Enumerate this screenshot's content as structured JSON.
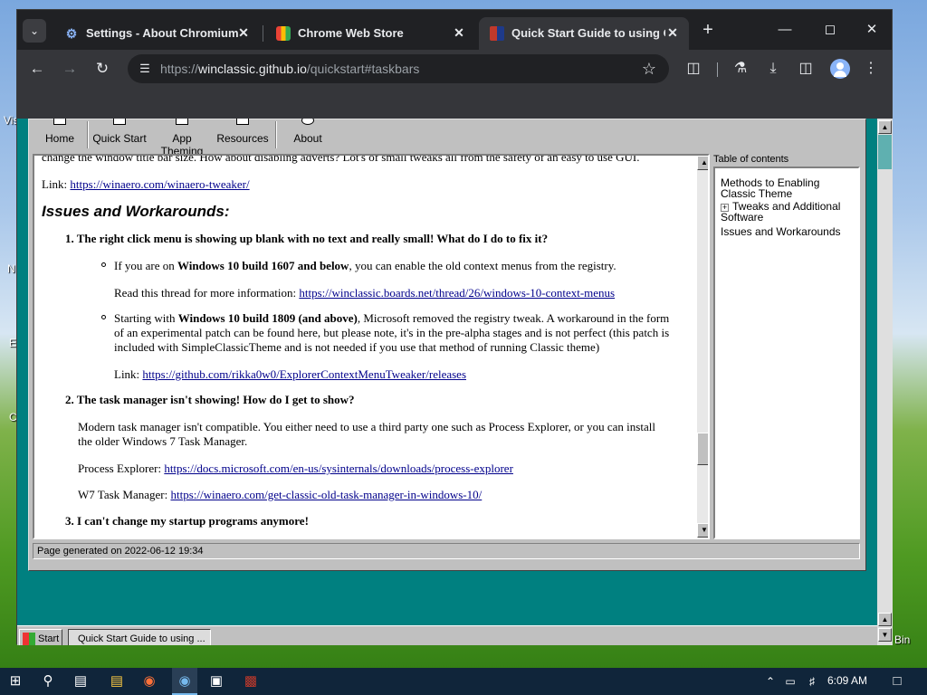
{
  "desktop": {
    "labels": [
      "Vis",
      "N",
      "E",
      "C",
      "Bin"
    ]
  },
  "browser": {
    "tabs": [
      {
        "title": "Settings - About Chromium",
        "icon": "gear-icon",
        "active": false
      },
      {
        "title": "Chrome Web Store",
        "icon": "webstore-icon",
        "active": false
      },
      {
        "title": "Quick Start Guide to using Cla",
        "icon": "windows-classic-icon",
        "active": true
      }
    ],
    "new_tab_glyph": "+",
    "url_prefix": "https://",
    "url_host": "winclassic.github.io",
    "url_path": "/quickstart#taskbars"
  },
  "app": {
    "toolbar": [
      {
        "label": "Home"
      },
      {
        "label": "Quick Start"
      },
      {
        "label": "App Theming"
      },
      {
        "label": "Resources"
      },
      {
        "label": "About"
      }
    ],
    "doc": {
      "cut_line": "change the window title bar size. How about disabling adverts? Lot's of small tweaks all from the safety of an easy to use GUI.",
      "link1_prefix": "Link: ",
      "link1": "https://winaero.com/winaero-tweaker/",
      "heading": "Issues and Workarounds:",
      "item1": "1. The right click menu is showing up blank with no text and really small! What do I do to fix it?",
      "b1_a": "If you are on ",
      "b1_b": "Windows 10 build 1607 and below",
      "b1_c": ", you can enable the old context menus from the registry.",
      "b1_read": "Read this thread for more information: ",
      "b1_link": "https://winclassic.boards.net/thread/26/windows-10-context-menus",
      "b2_a": "Starting with ",
      "b2_b": "Windows 10 build 1809 (and above)",
      "b2_c": ", Microsoft removed the registry tweak. A workaround in the form",
      "b2_l2": "of an experimental patch can be found here, but please note, it's in the pre-alpha stages and is not perfect (this patch is",
      "b2_l3": "included with SimpleClassicTheme and is not needed if you use that method of running Classic theme)",
      "b2_link_prefix": "Link: ",
      "b2_link": "https://github.com/rikka0w0/ExplorerContextMenuTweaker/releases",
      "item2": "2. The task manager isn't showing! How do I get to show?",
      "i2_l1": "Modern task manager isn't compatible. You either need to use a third party one such as Process Explorer, or you can install",
      "i2_l2": "the older Windows 7 Task Manager.",
      "pe_prefix": "Process Explorer: ",
      "pe_link": "https://docs.microsoft.com/en-us/sysinternals/downloads/process-explorer",
      "w7_prefix": "W7 Task Manager: ",
      "w7_link": "https://winaero.com/get-classic-old-task-manager-in-windows-10/",
      "item3": "3. I can't change my startup programs anymore!"
    },
    "toc": {
      "title": "Table of contents",
      "items": [
        "Methods to Enabling Classic Theme",
        "Tweaks and Additional Software",
        "Issues and Workarounds"
      ]
    },
    "status": "Page generated on 2022-06-12 19:34",
    "classic_taskbar": {
      "start": "Start",
      "task": "Quick Start Guide to using ..."
    }
  },
  "win_taskbar": {
    "time": "6:09 AM"
  }
}
